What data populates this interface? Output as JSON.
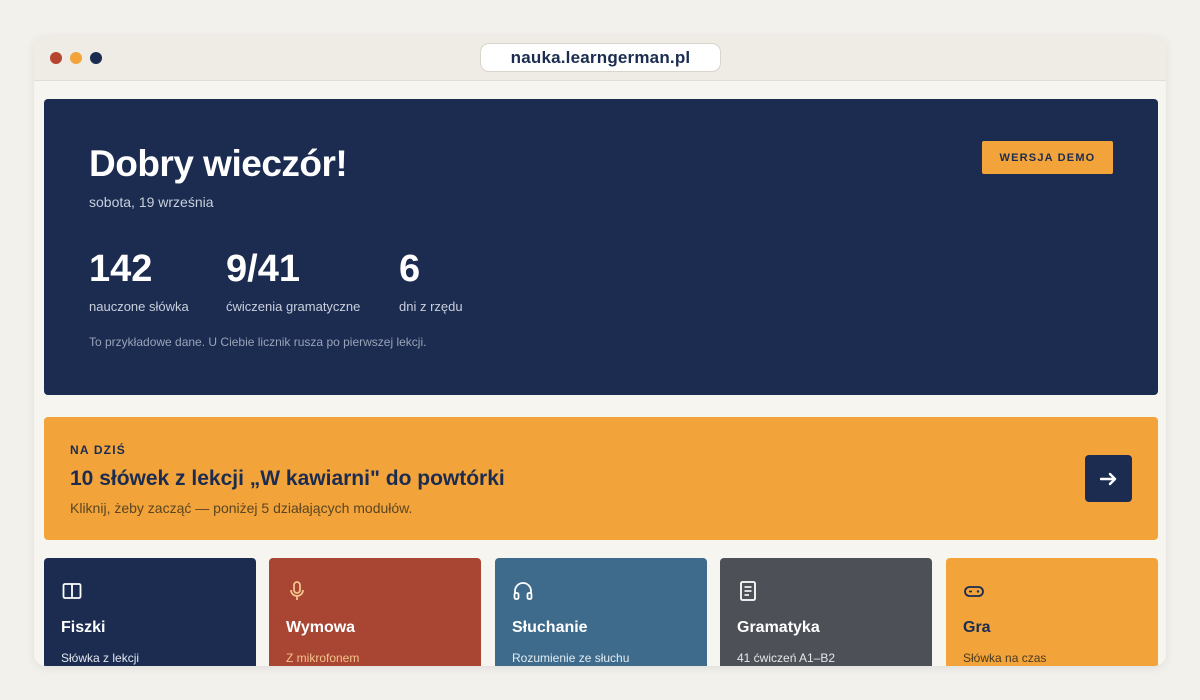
{
  "browser": {
    "url": "nauka.learngerman.pl"
  },
  "hero": {
    "greeting": "Dobry wieczór!",
    "date": "sobota, 19 września",
    "demo_label": "WERSJA DEMO",
    "stats": [
      {
        "value": "142",
        "label": "nauczone słówka"
      },
      {
        "value": "9/41",
        "label": "ćwiczenia gramatyczne"
      },
      {
        "value": "6",
        "label": "dni z rzędu"
      }
    ],
    "note": "To przykładowe dane. U Ciebie licznik rusza po pierwszej lekcji."
  },
  "today": {
    "kicker": "NA DZIŚ",
    "headline": "10 słówek z lekcji „W kawiarni\" do powtórki",
    "sub": "Kliknij, żeby zacząć — poniżej 5 działających modułów.",
    "arrow_icon": "arrow-right-icon"
  },
  "modules": [
    {
      "title": "Fiszki",
      "desc": "Słówka z lekcji",
      "icon": "book-open-icon",
      "color": "#1b2c50"
    },
    {
      "title": "Wymowa",
      "desc": "Z mikrofonem",
      "icon": "microphone-icon",
      "color": "#a84533"
    },
    {
      "title": "Słuchanie",
      "desc": "Rozumienie ze słuchu",
      "icon": "headphones-icon",
      "color": "#3e6b8c"
    },
    {
      "title": "Gramatyka",
      "desc": "41 ćwiczeń A1–B2",
      "icon": "document-icon",
      "color": "#4d5057"
    },
    {
      "title": "Gra",
      "desc": "Słówka na czas",
      "icon": "gamepad-icon",
      "color": "#f2a33a"
    }
  ]
}
